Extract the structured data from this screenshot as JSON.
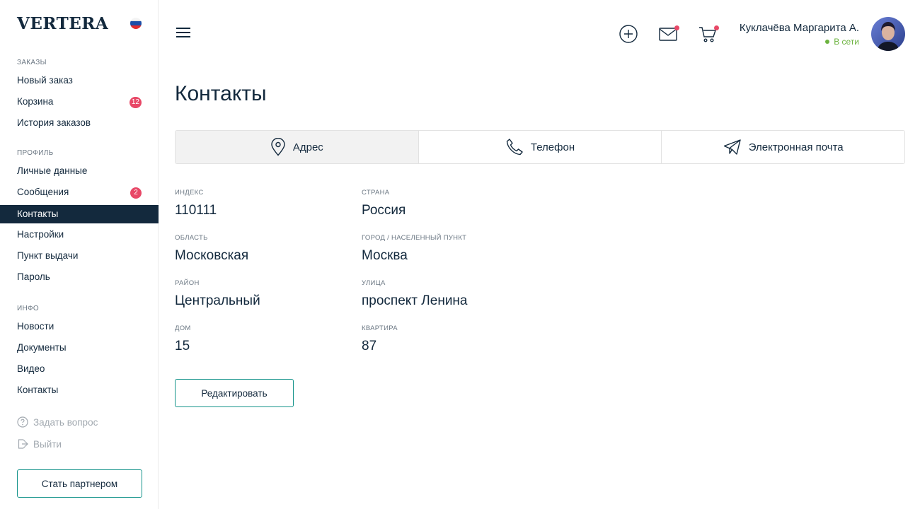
{
  "brand": {
    "logo": "VERTERA",
    "flag": "ru-flag"
  },
  "sidebar": {
    "sections": [
      {
        "title": "ЗАКАЗЫ",
        "items": [
          {
            "label": "Новый заказ"
          },
          {
            "label": "Корзина",
            "badge": "12"
          },
          {
            "label": "История заказов"
          }
        ]
      },
      {
        "title": "ПРОФИЛЬ",
        "items": [
          {
            "label": "Личные данные"
          },
          {
            "label": "Сообщения",
            "badge": "2"
          },
          {
            "label": "Контакты",
            "active": true
          },
          {
            "label": "Настройки"
          },
          {
            "label": "Пункт выдачи"
          },
          {
            "label": "Пароль"
          }
        ]
      },
      {
        "title": "ИНФО",
        "items": [
          {
            "label": "Новости"
          },
          {
            "label": "Документы"
          },
          {
            "label": "Видео"
          },
          {
            "label": "Контакты"
          }
        ]
      }
    ],
    "ask_question": "Задать вопрос",
    "logout": "Выйти",
    "partner_button": "Стать партнером"
  },
  "header": {
    "icons": [
      "menu-icon",
      "plus-circle-icon",
      "mail-icon",
      "cart-icon"
    ],
    "user_name": "Куклачёва Маргарита А.",
    "user_status": "В сети"
  },
  "main": {
    "title": "Контакты",
    "tabs": [
      {
        "label": "Адрес",
        "icon": "location-pin-icon",
        "active": true
      },
      {
        "label": "Телефон",
        "icon": "phone-icon"
      },
      {
        "label": "Электронная почта",
        "icon": "paper-plane-icon"
      }
    ],
    "fields": {
      "index": {
        "label": "ИНДЕКС",
        "value": "110111"
      },
      "country": {
        "label": "СТРАНА",
        "value": "Россия"
      },
      "region": {
        "label": "ОБЛАСТЬ",
        "value": "Московская"
      },
      "city": {
        "label": "ГОРОД / НАСЕЛЕННЫЙ ПУНКТ",
        "value": "Москва"
      },
      "district": {
        "label": "РАЙОН",
        "value": "Центральный"
      },
      "street": {
        "label": "УЛИЦА",
        "value": "проспект Ленина"
      },
      "house": {
        "label": "ДОМ",
        "value": "15"
      },
      "apartment": {
        "label": "КВАРТИРА",
        "value": "87"
      }
    },
    "edit_button": "Редактировать"
  },
  "colors": {
    "primary": "#13293d",
    "accent": "#14938a",
    "badge": "#e84867",
    "online": "#6cb33f",
    "muted": "#a2a9b0"
  }
}
